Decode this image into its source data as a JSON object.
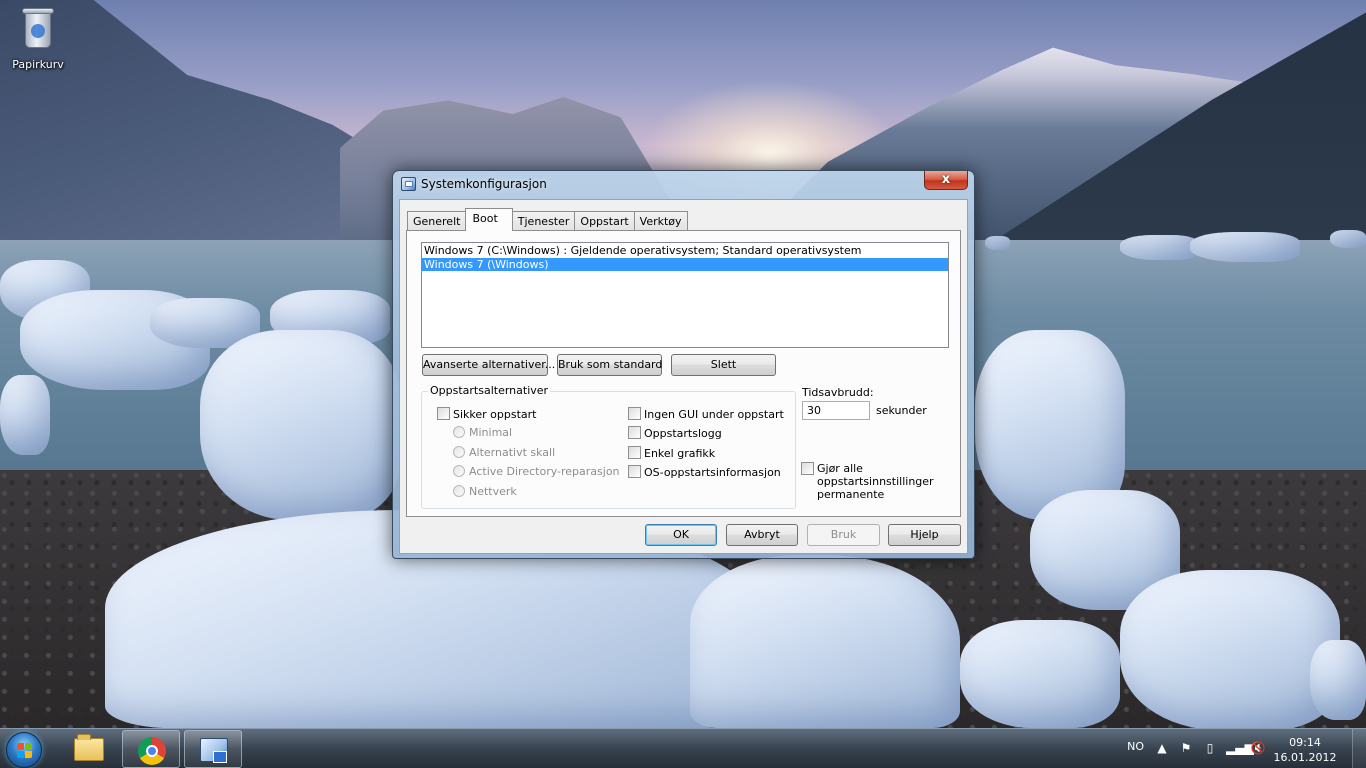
{
  "desktop": {
    "icons": [
      {
        "label": "Papirkurv",
        "icon": "recycle-bin-icon"
      }
    ]
  },
  "dialog": {
    "title": "Systemkonfigurasjon",
    "close_label": "x",
    "tabs": [
      "Generelt",
      "Boot",
      "Tjenester",
      "Oppstart",
      "Verktøy"
    ],
    "active_tab": "Boot",
    "os_list": [
      {
        "text": "Windows 7 (C:\\Windows) : Gjeldende operativsystem; Standard operativsystem",
        "selected": false
      },
      {
        "text": "Windows 7 (\\Windows)",
        "selected": true
      }
    ],
    "buttons": {
      "advanced": "Avanserte alternativer...",
      "set_default": "Bruk som standard",
      "delete": "Slett"
    },
    "boot_options": {
      "legend": "Oppstartsalternativer",
      "safe_boot": {
        "label": "Sikker oppstart",
        "checked": false
      },
      "radios": [
        {
          "label": "Minimal",
          "enabled": false
        },
        {
          "label": "Alternativt skall",
          "enabled": false
        },
        {
          "label": "Active Directory-reparasjon",
          "enabled": false
        },
        {
          "label": "Nettverk",
          "enabled": false
        }
      ],
      "checks": [
        {
          "label": "Ingen GUI under oppstart",
          "checked": false
        },
        {
          "label": "Oppstartslogg",
          "checked": false
        },
        {
          "label": "Enkel grafikk",
          "checked": false
        },
        {
          "label": "OS-oppstartsinformasjon",
          "checked": false
        }
      ]
    },
    "timeout": {
      "label": "Tidsavbrudd:",
      "value": "30",
      "unit": "sekunder"
    },
    "make_permanent": {
      "label": "Gjør alle oppstartsinnstillinger permanente",
      "checked": false
    },
    "footer": {
      "ok": "OK",
      "cancel": "Avbryt",
      "apply": "Bruk",
      "help": "Hjelp"
    }
  },
  "taskbar": {
    "language": "NO",
    "time": "09:14",
    "date": "16.01.2012",
    "pinned": [
      {
        "icon": "windows-explorer-icon",
        "active": false
      },
      {
        "icon": "chrome-icon",
        "active": false
      },
      {
        "icon": "msconfig-icon",
        "active": true
      }
    ],
    "tray_icons": [
      "show-hidden-icons-icon",
      "action-center-flag-icon",
      "battery-icon",
      "network-signal-icon",
      "volume-muted-icon"
    ]
  }
}
